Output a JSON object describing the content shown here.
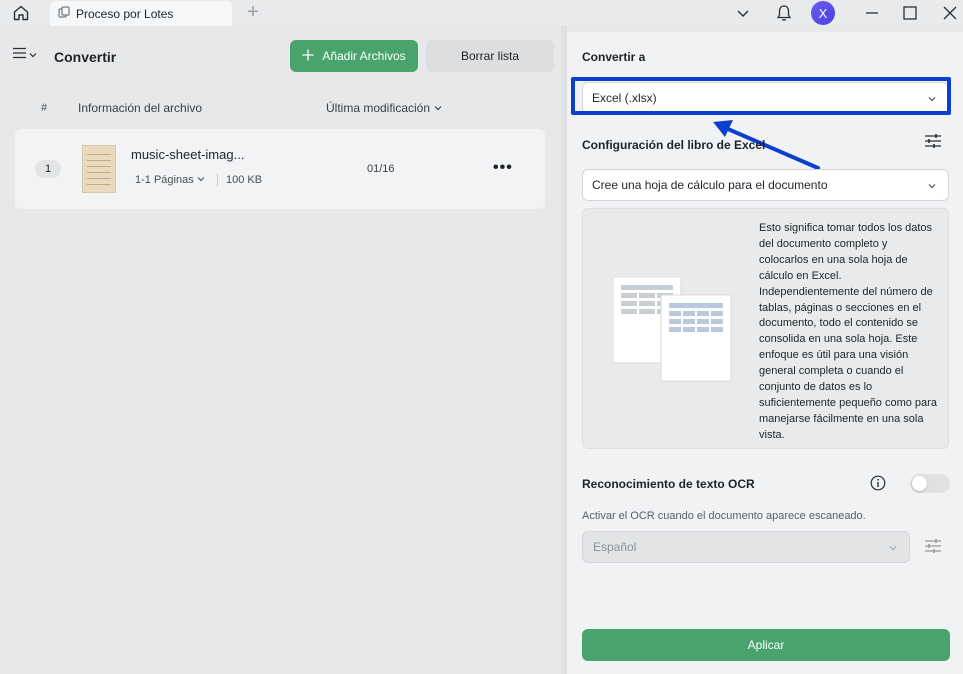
{
  "titlebar": {
    "tab_label": "Proceso por Lotes",
    "avatar_initial": "X"
  },
  "left": {
    "title": "Convertir",
    "add_files_label": "Añadir Archivos",
    "clear_list_label": "Borrar lista",
    "columns": {
      "index": "#",
      "info": "Información del archivo",
      "modified": "Última modificación"
    },
    "files": [
      {
        "index": "1",
        "name": "music-sheet-imag...",
        "pages": "1-1 Páginas",
        "size": "100 KB",
        "date": "01/16"
      }
    ]
  },
  "right": {
    "convert_to_title": "Convertir a",
    "format_value": "Excel (.xlsx)",
    "config_title": "Configuración del libro de Excel",
    "config_value": "Cree una hoja de cálculo para el documento",
    "description": "Esto significa tomar todos los datos del documento completo y colocarlos en una sola hoja de cálculo en Excel. Independientemente del número de tablas, páginas o secciones en el documento, todo el contenido se consolida en una sola hoja. Este enfoque es útil para una visión general completa o cuando el conjunto de datos es lo suficientemente pequeño como para manejarse fácilmente en una sola vista.",
    "ocr_title": "Reconocimiento de texto OCR",
    "ocr_enabled": false,
    "ocr_description": "Activar el OCR cuando el documento aparece escaneado.",
    "ocr_language": "Español",
    "apply_label": "Aplicar"
  },
  "colors": {
    "accent_green": "#48a46c",
    "highlight_blue": "#0b3fcf"
  }
}
